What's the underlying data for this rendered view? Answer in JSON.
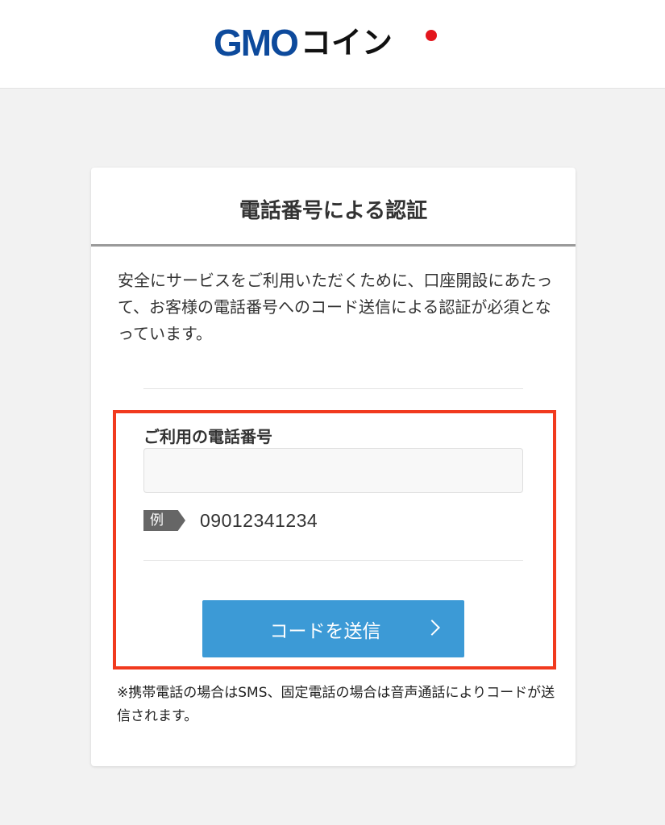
{
  "header": {
    "logo_gmo": "GMO",
    "logo_coin": "コイン"
  },
  "card": {
    "title": "電話番号による認証",
    "intro": "安全にサービスをご利用いただくために、口座開設にあたって、お客様の電話番号へのコード送信による認証が必須となっています。"
  },
  "form": {
    "phone_label": "ご利用の電話番号",
    "phone_value": "",
    "example_badge": "例",
    "example_value": "09012341234",
    "send_button_label": "コードを送信"
  },
  "note": "※携帯電話の場合はSMS、固定電話の場合は音声通話によりコードが送信されます。",
  "colors": {
    "brand_blue": "#0d4a9c",
    "brand_red": "#e3161d",
    "button_blue": "#3c9ad6",
    "highlight_red": "#f13a1e"
  }
}
